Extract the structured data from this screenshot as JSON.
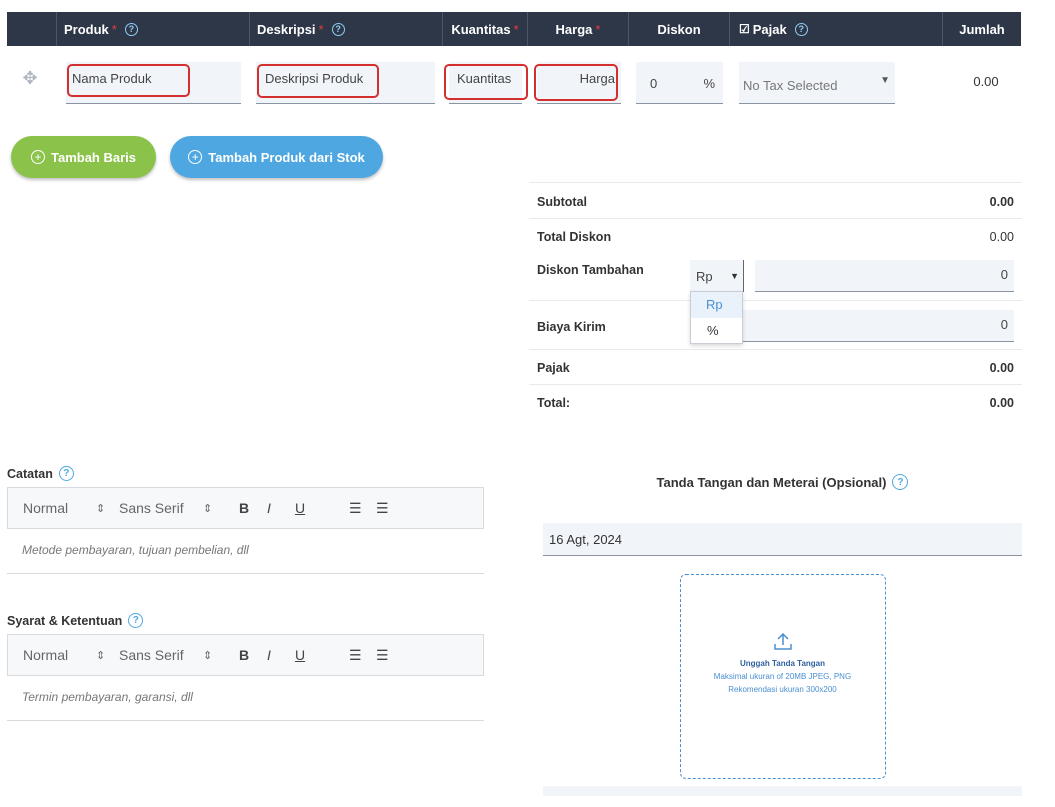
{
  "table": {
    "headers": {
      "produk": "Produk",
      "deskripsi": "Deskripsi",
      "kuantitas": "Kuantitas",
      "harga": "Harga",
      "diskon": "Diskon",
      "pajak": "Pajak",
      "jumlah": "Jumlah",
      "required_mark": "*"
    },
    "row": {
      "produk_placeholder": "Nama Produk",
      "deskripsi_placeholder": "Deskripsi Produk",
      "kuantitas_placeholder": "Kuantitas",
      "harga_placeholder": "Harga",
      "diskon_value": "0",
      "diskon_unit": "%",
      "pajak_value": "No Tax Selected",
      "jumlah": "0.00"
    }
  },
  "buttons": {
    "add_row": "Tambah Baris",
    "add_from_stock": "Tambah Produk dari Stok"
  },
  "summary": {
    "subtotal_label": "Subtotal",
    "subtotal_value": "0.00",
    "total_diskon_label": "Total Diskon",
    "total_diskon_value": "0.00",
    "diskon_tambahan_label": "Diskon Tambahan",
    "diskon_tambahan_unit": "Rp",
    "diskon_tambahan_value": "0",
    "dropdown_options": [
      "Rp",
      "%"
    ],
    "biaya_kirim_label": "Biaya Kirim",
    "biaya_kirim_value": "0",
    "pajak_label": "Pajak",
    "pajak_value": "0.00",
    "total_label": "Total:",
    "total_value": "0.00"
  },
  "notes": {
    "catatan_label": "Catatan",
    "catatan_placeholder": "Metode pembayaran, tujuan pembelian, dll",
    "syarat_label": "Syarat & Ketentuan",
    "syarat_placeholder": "Termin pembayaran, garansi, dll",
    "toolbar": {
      "format": "Normal",
      "font": "Sans Serif",
      "bold": "B",
      "italic": "I",
      "underline": "U"
    }
  },
  "signature": {
    "title": "Tanda Tangan dan Meterai (Opsional)",
    "date": "16 Agt, 2024",
    "upload_title": "Unggah Tanda Tangan",
    "upload_hint1": "Maksimal ukuran of 20MB JPEG, PNG",
    "upload_hint2": "Rekomendasi ukuran 300x200"
  },
  "colors": {
    "header_bg": "#2d3748",
    "green_button": "#8bc34a",
    "blue_button": "#4ea7e0",
    "required": "#e53e3e",
    "highlight_border": "#d32f2f"
  }
}
